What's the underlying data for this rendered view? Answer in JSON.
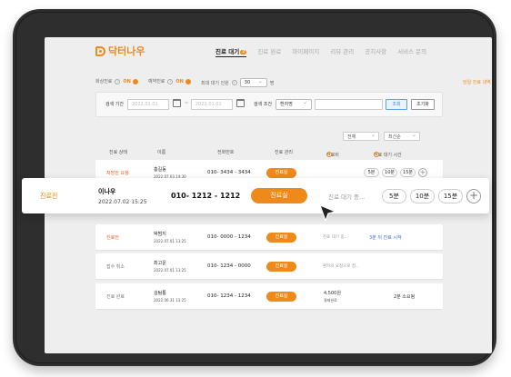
{
  "brand": {
    "name": "닥터나우",
    "color": "#ee8a1c"
  },
  "nav": {
    "tabs": [
      {
        "label": "진료 대기",
        "count": "2",
        "active": true
      },
      {
        "label": "진료 완료",
        "active": false
      },
      {
        "label": "마이페이지",
        "active": false
      },
      {
        "label": "리뷰 관리",
        "active": false
      },
      {
        "label": "공지사항",
        "active": false
      },
      {
        "label": "서비스 문의",
        "active": false
      }
    ]
  },
  "settings": {
    "video_label": "화상진료",
    "video_state": "ON",
    "reservation_label": "예약진료",
    "reservation_state": "ON",
    "max_wait_label": "최대 대기 인원",
    "max_wait_value": "30",
    "max_wait_unit": "명",
    "today_history_link": "당일 진료 내역"
  },
  "filter": {
    "period_label": "검색 기간",
    "start_date": "2022.01.01",
    "separator": "~",
    "end_date": "2022.01.01",
    "condition_label": "검색 조건",
    "condition_value": "환자명",
    "keyword_value": "",
    "search_button": "조회",
    "reset_button": "초기화"
  },
  "sort": {
    "filter_all": "전체",
    "order": "최신순"
  },
  "table": {
    "headers": {
      "status": "진료 상태",
      "name": "이름",
      "phone": "전화번호",
      "manage": "진료 관리",
      "fee": "진료비",
      "wait_time": "진료 대기 시간"
    },
    "rows": [
      {
        "status": "처방전 요청",
        "name": "홍길동",
        "date": "2022.07.03  14:30",
        "phone": "010- 3434 - 3434",
        "button": "진료실",
        "fee": "",
        "chips": [
          "5분",
          "10분",
          "15분"
        ]
      },
      {
        "status": "진료전",
        "name": "이나우",
        "date": "2022.07.02  15:25",
        "phone": "010- 1212 - 1212",
        "button": "진료실",
        "wait": "진료 대기 중...",
        "chips": [
          "5분",
          "10분",
          "15분"
        ]
      },
      {
        "status": "진료전",
        "name": "박범지",
        "date": "2022.07.01  13:25",
        "phone": "010- 0000 - 1234",
        "button": "진료실",
        "wait": "진료 대기 중...",
        "note": "3분 뒤 진료 시작"
      },
      {
        "status": "접수 취소",
        "name": "최고운",
        "date": "2022.07.01  13:25",
        "phone": "010- 1234 - 0000",
        "button": "진료실",
        "wait": "환자의 요청으로 접...",
        "note": ""
      },
      {
        "status": "진료 완료",
        "name": "김팀통",
        "date": "2022.06.31  13:25",
        "phone": "010- 1234 - 1234",
        "button": "진료실",
        "fee": "4,500원",
        "fee_sub": "결제완료",
        "note": "2분 소요됨"
      }
    ]
  }
}
